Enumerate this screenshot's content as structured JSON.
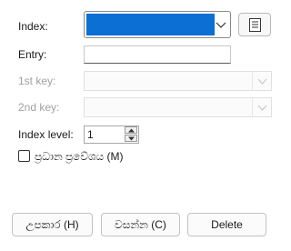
{
  "form": {
    "index_label": "Index:",
    "entry_label": "Entry:",
    "key1_label": "1st key:",
    "key2_label": "2nd key:",
    "index_level_label": "Index level:",
    "index_level_value": "1",
    "main_entry_label": "ප්‍රධාන ප්‍රවේශය (M)",
    "main_entry_checked": false
  },
  "buttons": {
    "help": "උපකාර (H)",
    "cancel": "වසන්න (C)",
    "delete": "Delete"
  },
  "colors": {
    "selected_fill": "#0b6fd4",
    "disabled_text": "#a0a0a0"
  },
  "icons": {
    "edit_index": "document-list-icon",
    "dropdown": "chevron-down-icon"
  }
}
